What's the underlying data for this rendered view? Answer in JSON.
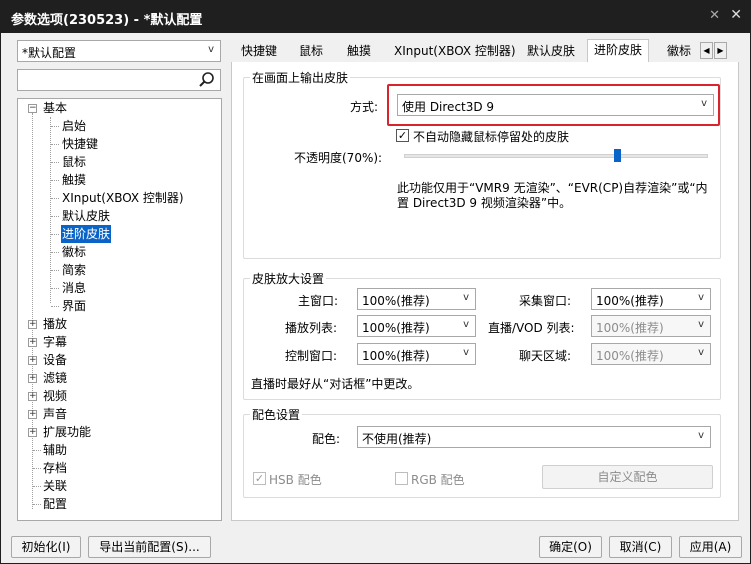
{
  "window": {
    "title": "参数选项(230523) - *默认配置",
    "pin_icon": "pin-icon",
    "close_icon": "close-icon"
  },
  "profile": {
    "selected": "*默认配置"
  },
  "search": {
    "placeholder": ""
  },
  "tree": {
    "root": {
      "label": "基本",
      "children": [
        "启始",
        "快捷键",
        "鼠标",
        "触摸",
        "XInput(XBOX 控制器)",
        "默认皮肤",
        "进阶皮肤",
        "徽标",
        "简索",
        "消息",
        "界面"
      ]
    },
    "selected": "进阶皮肤",
    "collapsed": [
      "播放",
      "字幕",
      "设备",
      "滤镜",
      "视频",
      "声音",
      "扩展功能"
    ],
    "leaves": [
      "辅助",
      "存档",
      "关联",
      "配置"
    ]
  },
  "tabs": [
    "快捷键",
    "鼠标",
    "触摸",
    "XInput(XBOX 控制器)",
    "默认皮肤",
    "进阶皮肤",
    "徽标"
  ],
  "active_tab": "进阶皮肤",
  "output": {
    "group_title": "在画面上输出皮肤",
    "method_label": "方式:",
    "method_value": "使用 Direct3D 9",
    "autohide_label": "不自动隐藏鼠标停留处的皮肤",
    "autohide_checked": true,
    "opacity_label": "不透明度(70%):",
    "opacity_value": 0.7,
    "note_line1": "此功能仅用于“VMR9 无渲染”、“EVR(CP)自荐渲染”或“内",
    "note_line2": "置 Direct3D 9 视频渲染器”中。"
  },
  "zoom": {
    "group_title": "皮肤放大设置",
    "main_window_label": "主窗口:",
    "main_window_value": "100%(推荐)",
    "playlist_label": "播放列表:",
    "playlist_value": "100%(推荐)",
    "control_label": "控制窗口:",
    "control_value": "100%(推荐)",
    "capture_label": "采集窗口:",
    "capture_value": "100%(推荐)",
    "live_label": "直播/VOD 列表:",
    "live_value": "100%(推荐)",
    "chat_label": "聊天区域:",
    "chat_value": "100%(推荐)",
    "note": "直播时最好从“对话框”中更改。"
  },
  "color": {
    "group_title": "配色设置",
    "scheme_label": "配色:",
    "scheme_value": "不使用(推荐)",
    "hsb_label": "HSB 配色",
    "hsb_checked": true,
    "rgb_label": "RGB 配色",
    "rgb_checked": false,
    "custom_button": "自定义配色"
  },
  "footer": {
    "init": "初始化(I)",
    "export": "导出当前配置(S)...",
    "ok": "确定(O)",
    "cancel": "取消(C)",
    "apply": "应用(A)"
  },
  "accent_color": "#0a64c8",
  "highlight_color": "#d9232d"
}
